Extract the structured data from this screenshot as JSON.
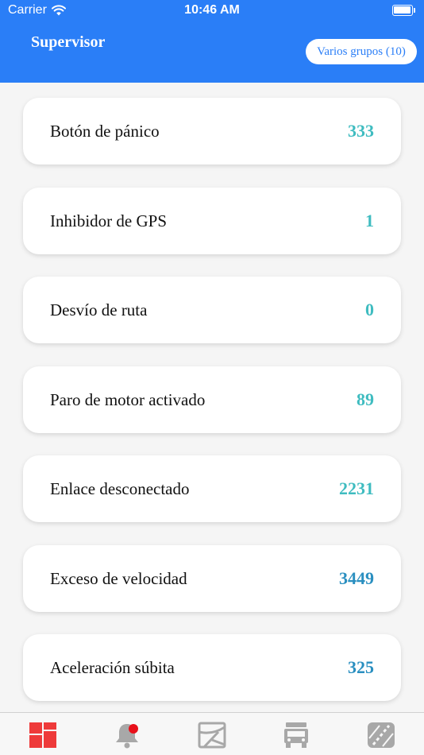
{
  "status_bar": {
    "carrier": "Carrier",
    "time": "10:46 AM"
  },
  "header": {
    "title": "Supervisor",
    "group_button": "Varios grupos (10)"
  },
  "alerts": [
    {
      "label": "Botón de pánico",
      "count": "333",
      "color": "#3fbcc0"
    },
    {
      "label": "Inhibidor de GPS",
      "count": "1",
      "color": "#3fbcc0"
    },
    {
      "label": "Desvío de ruta",
      "count": "0",
      "color": "#3fbcc0"
    },
    {
      "label": "Paro de motor activado",
      "count": "89",
      "color": "#3fbcc0"
    },
    {
      "label": "Enlace desconectado",
      "count": "2231",
      "color": "#3fbcc0"
    },
    {
      "label": "Exceso de velocidad",
      "count": "3449",
      "color": "#2a8fc0"
    },
    {
      "label": "Aceleración súbita",
      "count": "325",
      "color": "#2a8fc0"
    }
  ],
  "tab_bar": {
    "tabs": [
      {
        "icon": "dashboard-icon",
        "active": true
      },
      {
        "icon": "bell-icon",
        "active": false
      },
      {
        "icon": "map-icon",
        "active": false
      },
      {
        "icon": "truck-icon",
        "active": false
      },
      {
        "icon": "road-icon",
        "active": false
      }
    ]
  },
  "colors": {
    "header": "#2a7ef7",
    "active_tab": "#ee3a3a",
    "inactive_tab": "#a8a8a8",
    "notification_dot": "#e8101a"
  }
}
